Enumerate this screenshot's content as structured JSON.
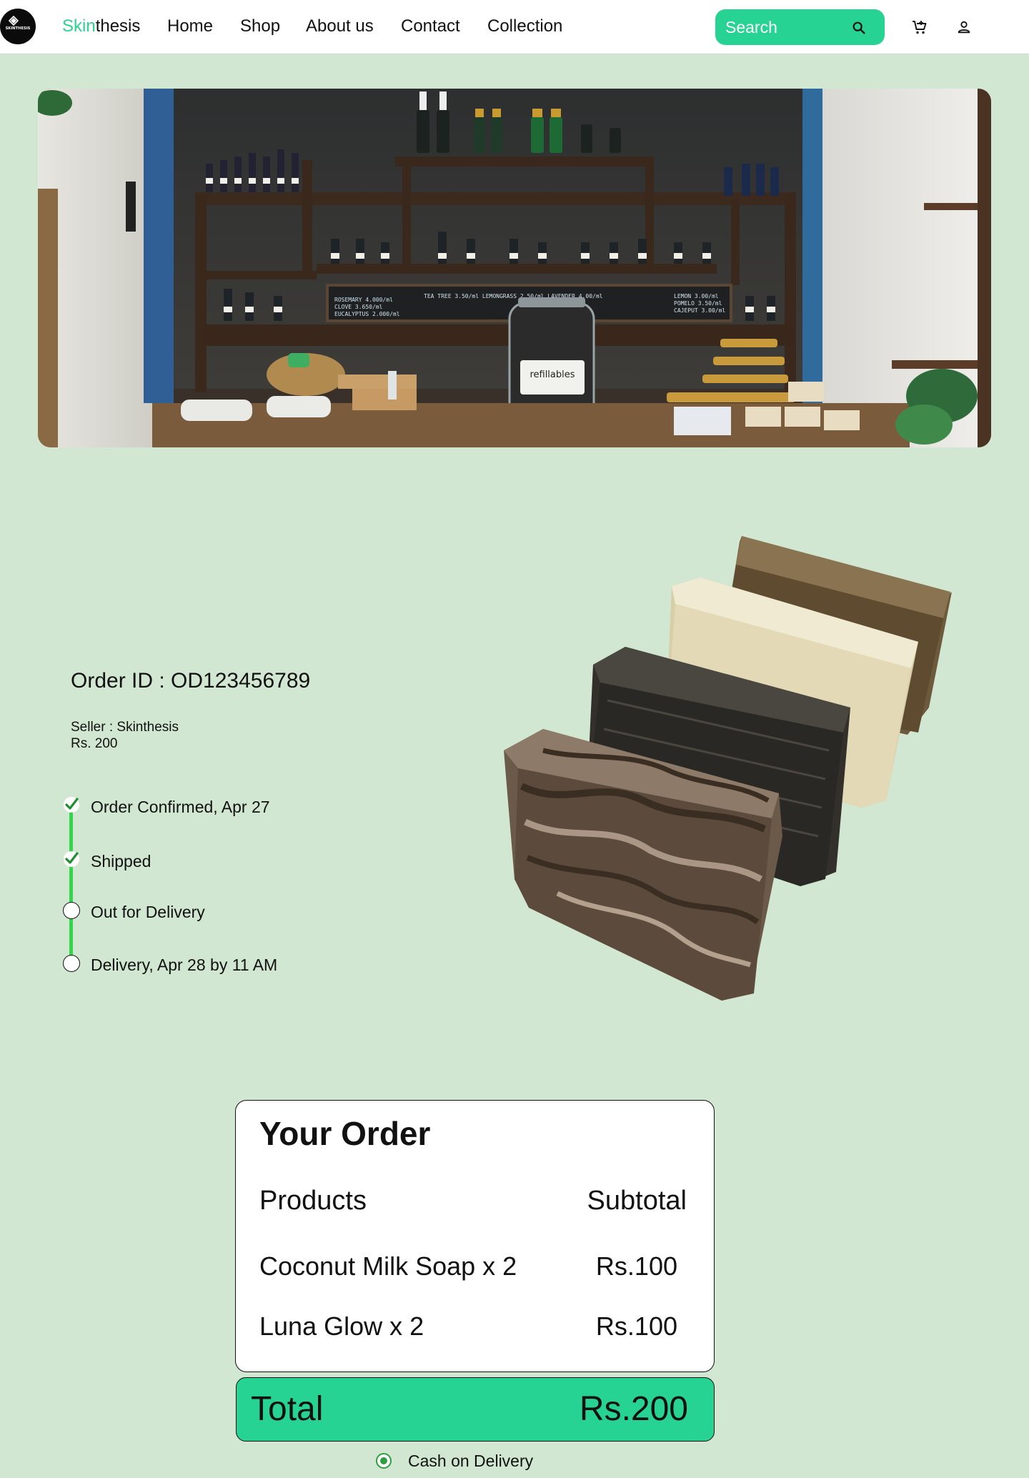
{
  "navbar": {
    "logo_text": "SKINTHESIS",
    "brand_accent": "Skin",
    "brand_rest": "thesis",
    "links": [
      "Home",
      "Shop",
      "About us",
      "Contact",
      "Collection"
    ],
    "search_placeholder": "Search",
    "icons": [
      "search-icon",
      "cart-icon",
      "user-icon"
    ]
  },
  "hero": {
    "shelf_label": "refillables"
  },
  "order": {
    "id_text": "Order ID : OD123456789",
    "seller_text": "Seller : Skinthesis",
    "price_text": "Rs. 200",
    "tracking": [
      {
        "label": "Order Confirmed, Apr 27",
        "done": true
      },
      {
        "label": "Shipped",
        "done": true
      },
      {
        "label": "Out for Delivery",
        "done": false
      },
      {
        "label": "Delivery, Apr 28 by 11 AM",
        "done": false
      }
    ]
  },
  "summary": {
    "title": "Your Order",
    "col_products": "Products",
    "col_subtotal": "Subtotal",
    "items": [
      {
        "name": "Coconut Milk Soap x 2",
        "subtotal": "Rs.100"
      },
      {
        "name": "Luna Glow x 2",
        "subtotal": "Rs.100"
      }
    ],
    "total_label": "Total",
    "total_value": "Rs.200",
    "payment_method": "Cash on Delivery"
  },
  "colors": {
    "page_bg": "#d1e7d1",
    "accent": "#26d392",
    "brand_accent": "#2bd38f",
    "progress": "#33d64a"
  }
}
